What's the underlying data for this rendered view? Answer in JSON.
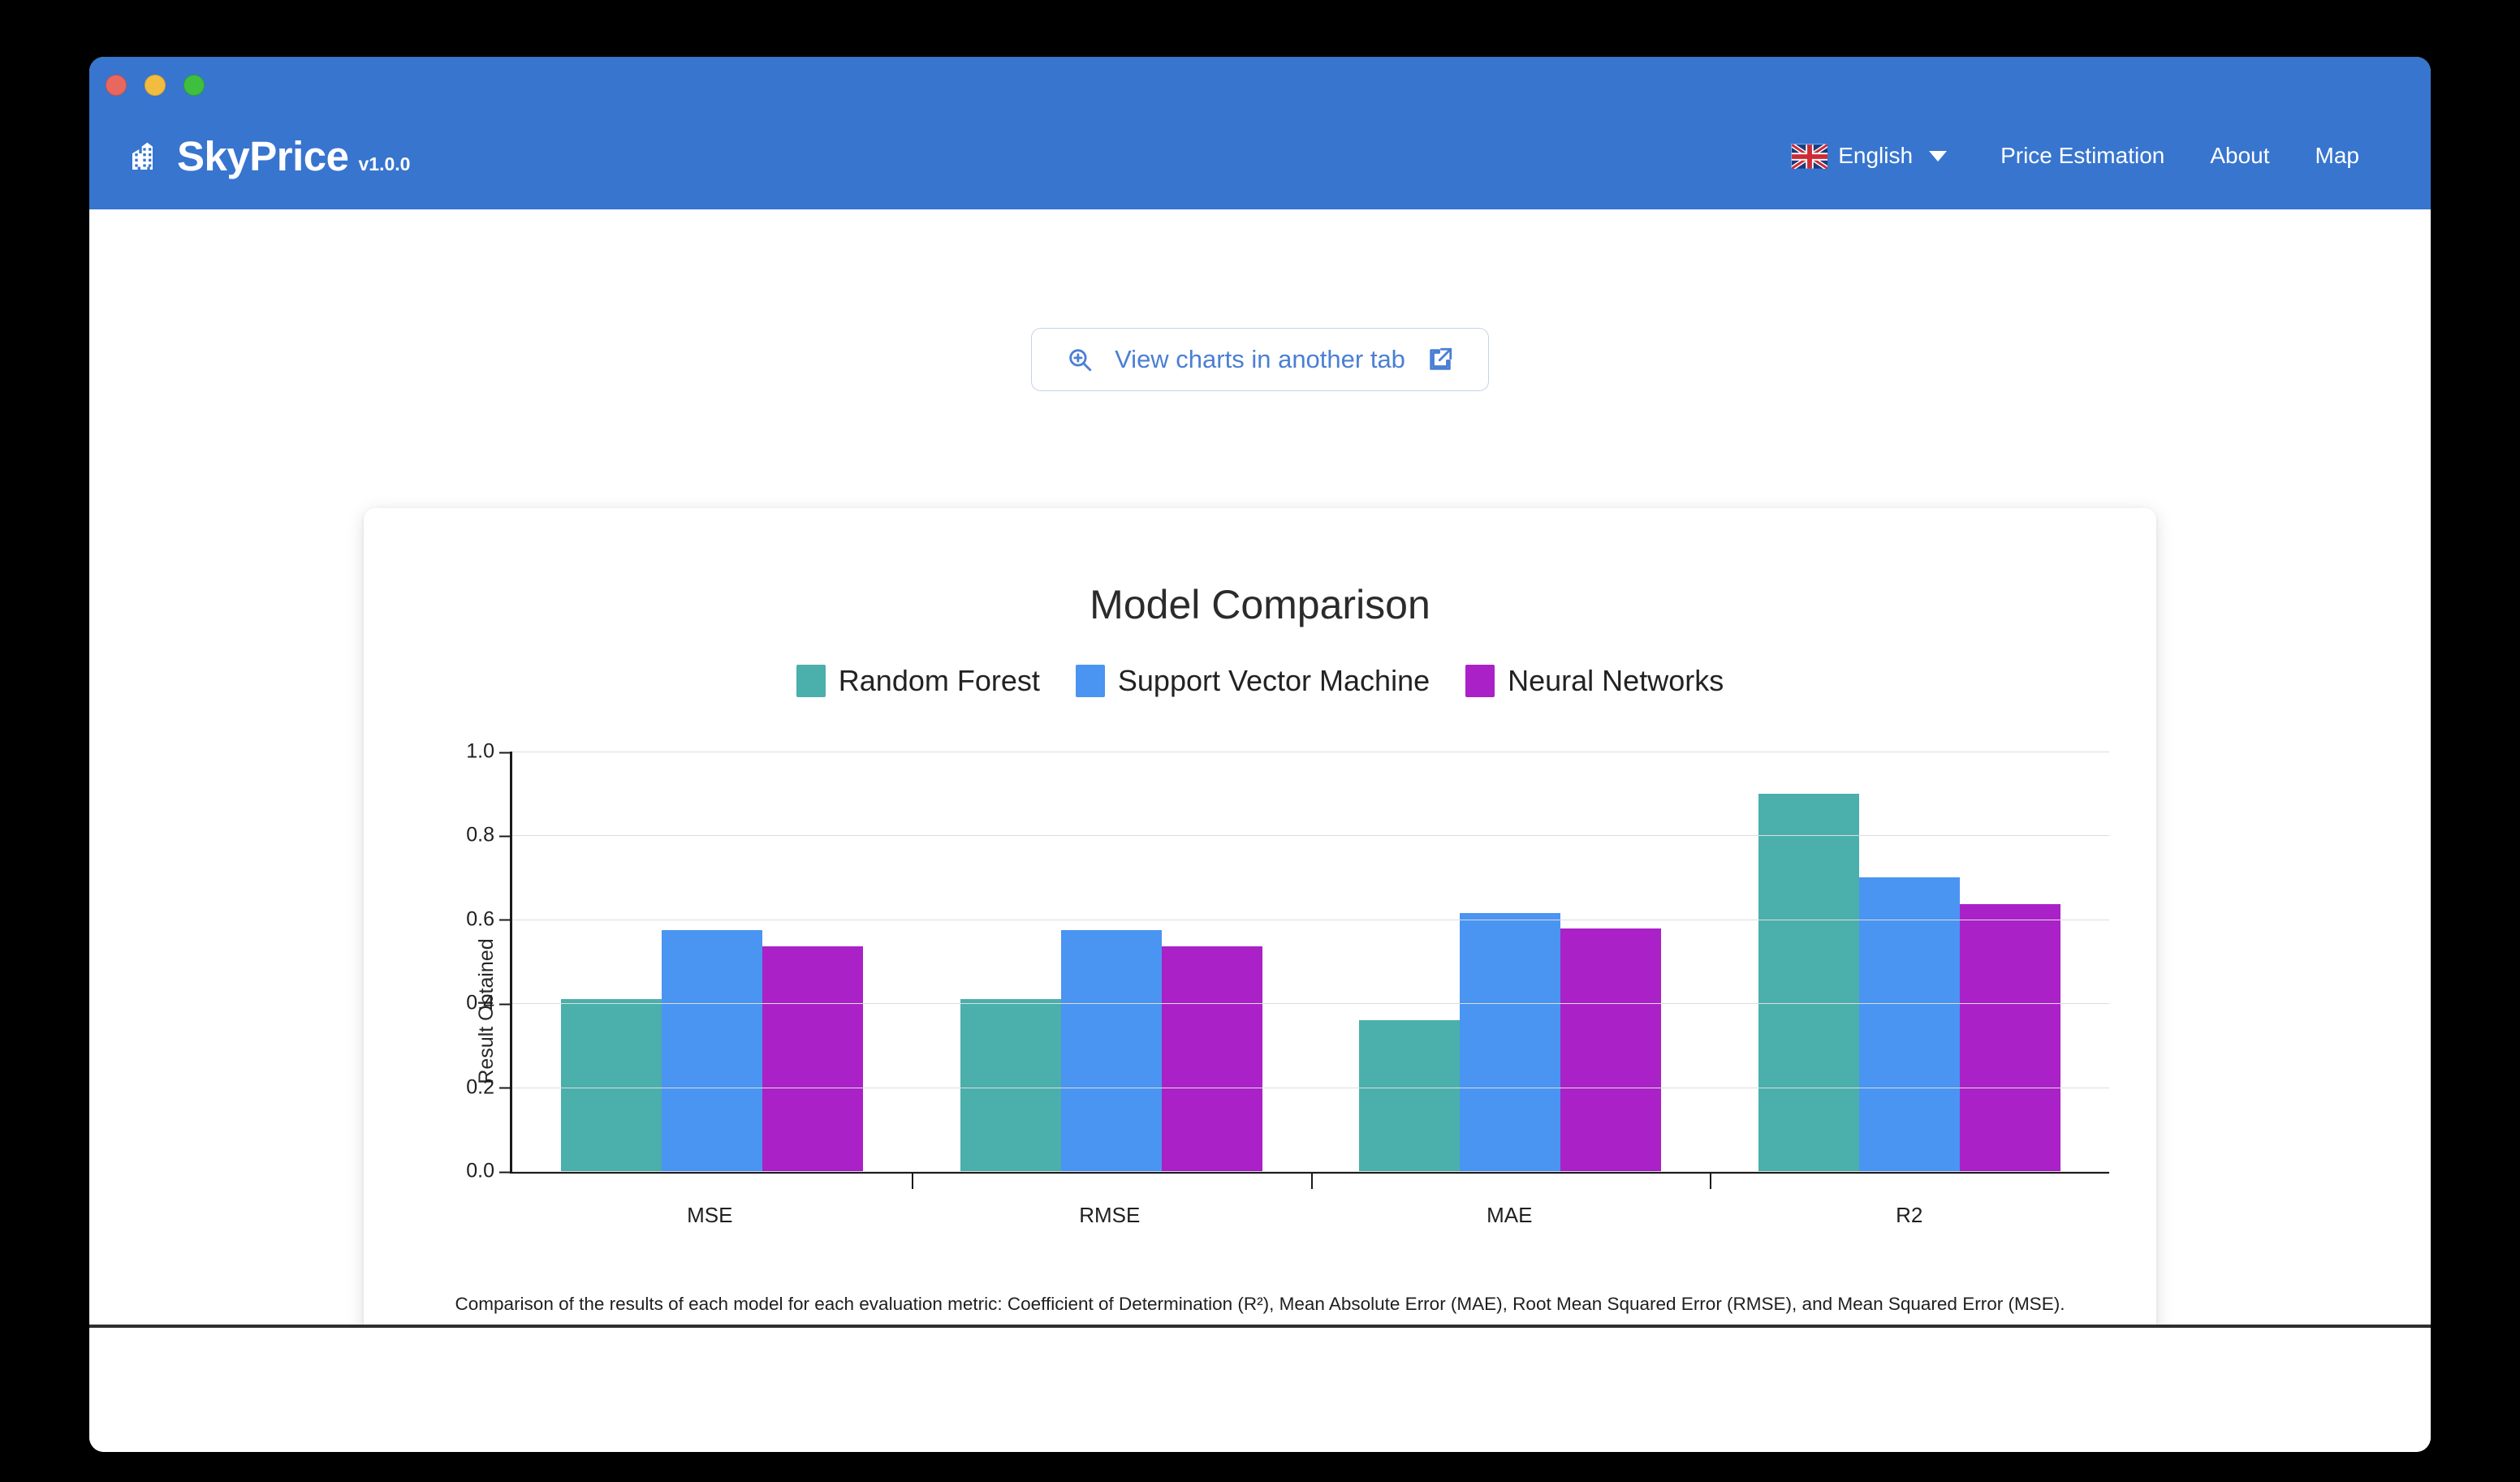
{
  "window": {
    "traffic_lights": [
      "close",
      "minimize",
      "zoom"
    ]
  },
  "header": {
    "brand_name": "SkyPrice",
    "brand_version": "v1.0.0",
    "brand_icon": "building-icon",
    "background_color": "#3775cf",
    "language": {
      "flag_icon": "uk-flag-icon",
      "label": "English",
      "caret_icon": "chevron-down-icon"
    },
    "nav_links": [
      {
        "label": "Price Estimation"
      },
      {
        "label": "About"
      },
      {
        "label": "Map"
      }
    ]
  },
  "toolbar": {
    "view_charts_label": "View charts in another tab",
    "left_icon": "zoom-in-icon",
    "right_icon": "external-link-icon",
    "accent_color": "#4a7fd4"
  },
  "chart_card": {
    "caption": "Comparison of the results of each model for each evaluation metric: Coefficient of Determination (R²), Mean Absolute Error (MAE), Root Mean Squared Error (RMSE), and Mean Squared Error (MSE)."
  },
  "chart_data": {
    "type": "bar",
    "title": "Model Comparison",
    "xlabel": "",
    "ylabel": "Result Obtained",
    "ylim": [
      0.0,
      1.0
    ],
    "yticks": [
      "0.0",
      "0.2",
      "0.4",
      "0.6",
      "0.8",
      "1.0"
    ],
    "ytick_values": [
      0.0,
      0.2,
      0.4,
      0.6,
      0.8,
      1.0
    ],
    "grid": true,
    "legend_position": "top",
    "categories": [
      "MSE",
      "RMSE",
      "MAE",
      "R2"
    ],
    "series": [
      {
        "name": "Random Forest",
        "color": "#4bafab",
        "values": [
          0.41,
          0.41,
          0.36,
          0.9
        ]
      },
      {
        "name": "Support Vector Machine",
        "color": "#4a94f2",
        "values": [
          0.575,
          0.575,
          0.615,
          0.7
        ]
      },
      {
        "name": "Neural Networks",
        "color": "#ab21c8",
        "values": [
          0.535,
          0.535,
          0.578,
          0.637
        ]
      }
    ]
  }
}
